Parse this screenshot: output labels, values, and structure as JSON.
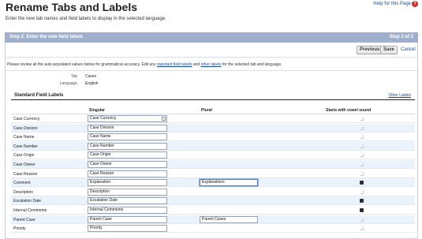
{
  "header": {
    "title": "Rename Tabs and Labels",
    "help_link": "Help for this Page",
    "help_icon": "question-icon",
    "intro": "Enter the new tab names and field labels to display in the selected language."
  },
  "step": {
    "title": "Step 2. Enter the new field labels",
    "counter": "Step 2 of 2"
  },
  "buttons": {
    "previous": "Previous",
    "save": "Save",
    "cancel": "Cancel"
  },
  "review": {
    "before": "Please review all the auto-populated values below for grammatical accuracy. Edit any ",
    "link1": "standard field labels",
    "middle": " and ",
    "link2": "other labels",
    "after": " for the selected tab and language."
  },
  "meta": {
    "tab_label": "Tab",
    "tab_value": "Cases",
    "language_label": "Language",
    "language_value": "English"
  },
  "section": {
    "title": "Standard Field Labels",
    "other_labels_link": "Other Labels"
  },
  "columns": {
    "singular": "Singular",
    "plural": "Plural",
    "vowel": "Starts with vowel sound"
  },
  "rows": [
    {
      "name": "Case Currency",
      "singular": "Case Currency",
      "plural": "",
      "vowel": false,
      "lookup": true
    },
    {
      "name": "Case Division",
      "singular": "Case Division",
      "plural": "",
      "vowel": false
    },
    {
      "name": "Case Name",
      "singular": "Case Name",
      "plural": "",
      "vowel": false
    },
    {
      "name": "Case Number",
      "singular": "Case Number",
      "plural": "",
      "vowel": false
    },
    {
      "name": "Case Origin",
      "singular": "Case Origin",
      "plural": "",
      "vowel": false
    },
    {
      "name": "Case Owner",
      "singular": "Case Owner",
      "plural": "",
      "vowel": false
    },
    {
      "name": "Case Reason",
      "singular": "Case Reason",
      "plural": "",
      "vowel": false
    },
    {
      "name": "Comment",
      "singular": "Explanation",
      "plural": "Explanations",
      "vowel": true,
      "plural_focused": true
    },
    {
      "name": "Description",
      "singular": "Description",
      "plural": "",
      "vowel": false
    },
    {
      "name": "Escalation Date",
      "singular": "Escalation Date",
      "plural": "",
      "vowel": true
    },
    {
      "name": "Internal Comments",
      "singular": "Internal Comments",
      "plural": "",
      "vowel": true
    },
    {
      "name": "Parent Case",
      "singular": "Parent Case",
      "plural": "Parent Cases",
      "vowel": false
    },
    {
      "name": "Priority",
      "singular": "Priority",
      "plural": "",
      "vowel": false
    }
  ],
  "colors": {
    "step_bar": "#a0b0cc",
    "row_alt": "#eaf2fb",
    "link": "#1a4d8f"
  }
}
